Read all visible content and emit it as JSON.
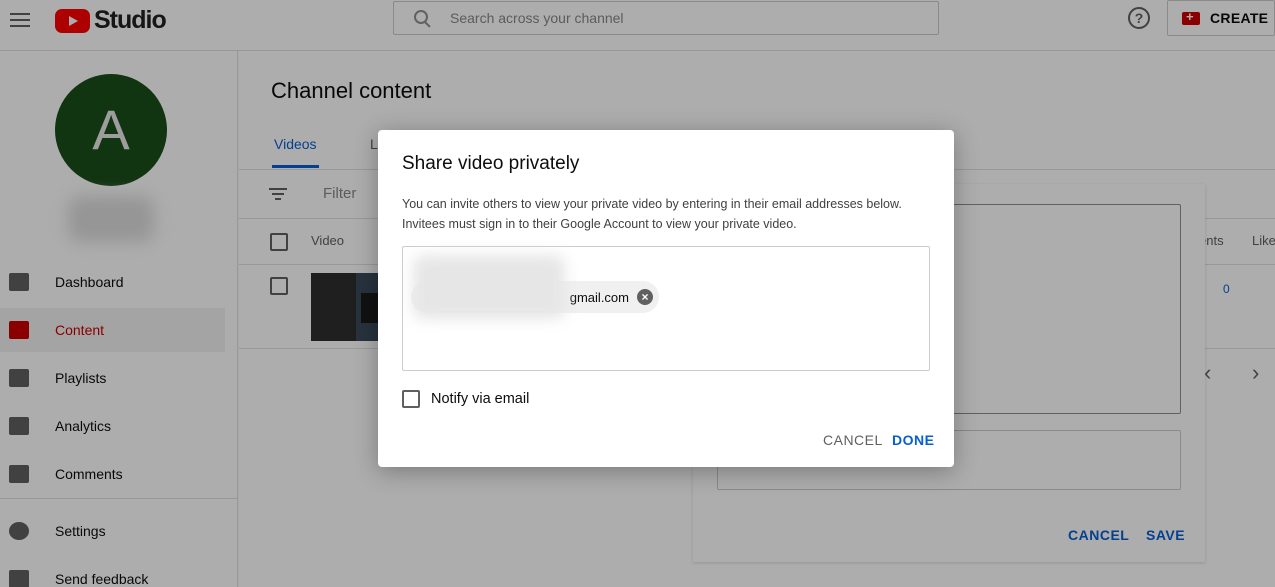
{
  "header": {
    "logo_text": "Studio",
    "search_placeholder": "Search across your channel",
    "help_symbol": "?",
    "create_label": "CREATE"
  },
  "sidebar": {
    "avatar_letter": "A",
    "items": [
      {
        "label": "Dashboard",
        "icon": "dashboard-icon"
      },
      {
        "label": "Content",
        "icon": "content-icon",
        "active": true
      },
      {
        "label": "Playlists",
        "icon": "playlists-icon"
      },
      {
        "label": "Analytics",
        "icon": "analytics-icon"
      },
      {
        "label": "Comments",
        "icon": "comments-icon"
      },
      {
        "label": "Settings",
        "icon": "gear-icon"
      },
      {
        "label": "Send feedback",
        "icon": "feedback-icon"
      }
    ]
  },
  "main": {
    "title": "Channel content",
    "tabs": [
      {
        "label": "Videos"
      },
      {
        "label": "L"
      }
    ],
    "filter_label": "Filter",
    "columns": {
      "video": "Video",
      "comments": "ents",
      "likes": "Like"
    },
    "row": {
      "comments": "0"
    }
  },
  "bg_panel": {
    "cancel_label": "CANCEL",
    "save_label": "SAVE",
    "chevron_left": "‹",
    "chevron_right": "›"
  },
  "dialog": {
    "title": "Share video privately",
    "description": "You can invite others to view your private video by entering in their email addresses below. Invitees must sign in to their Google Account to view your private video.",
    "chip_text": "gmail.com",
    "chip_remove": "×",
    "notify_label": "Notify via email",
    "cancel_label": "CANCEL",
    "done_label": "DONE"
  },
  "colors": {
    "accent": "#065fd4",
    "brand": "#ff0000",
    "active_nav": "#cc0000"
  }
}
